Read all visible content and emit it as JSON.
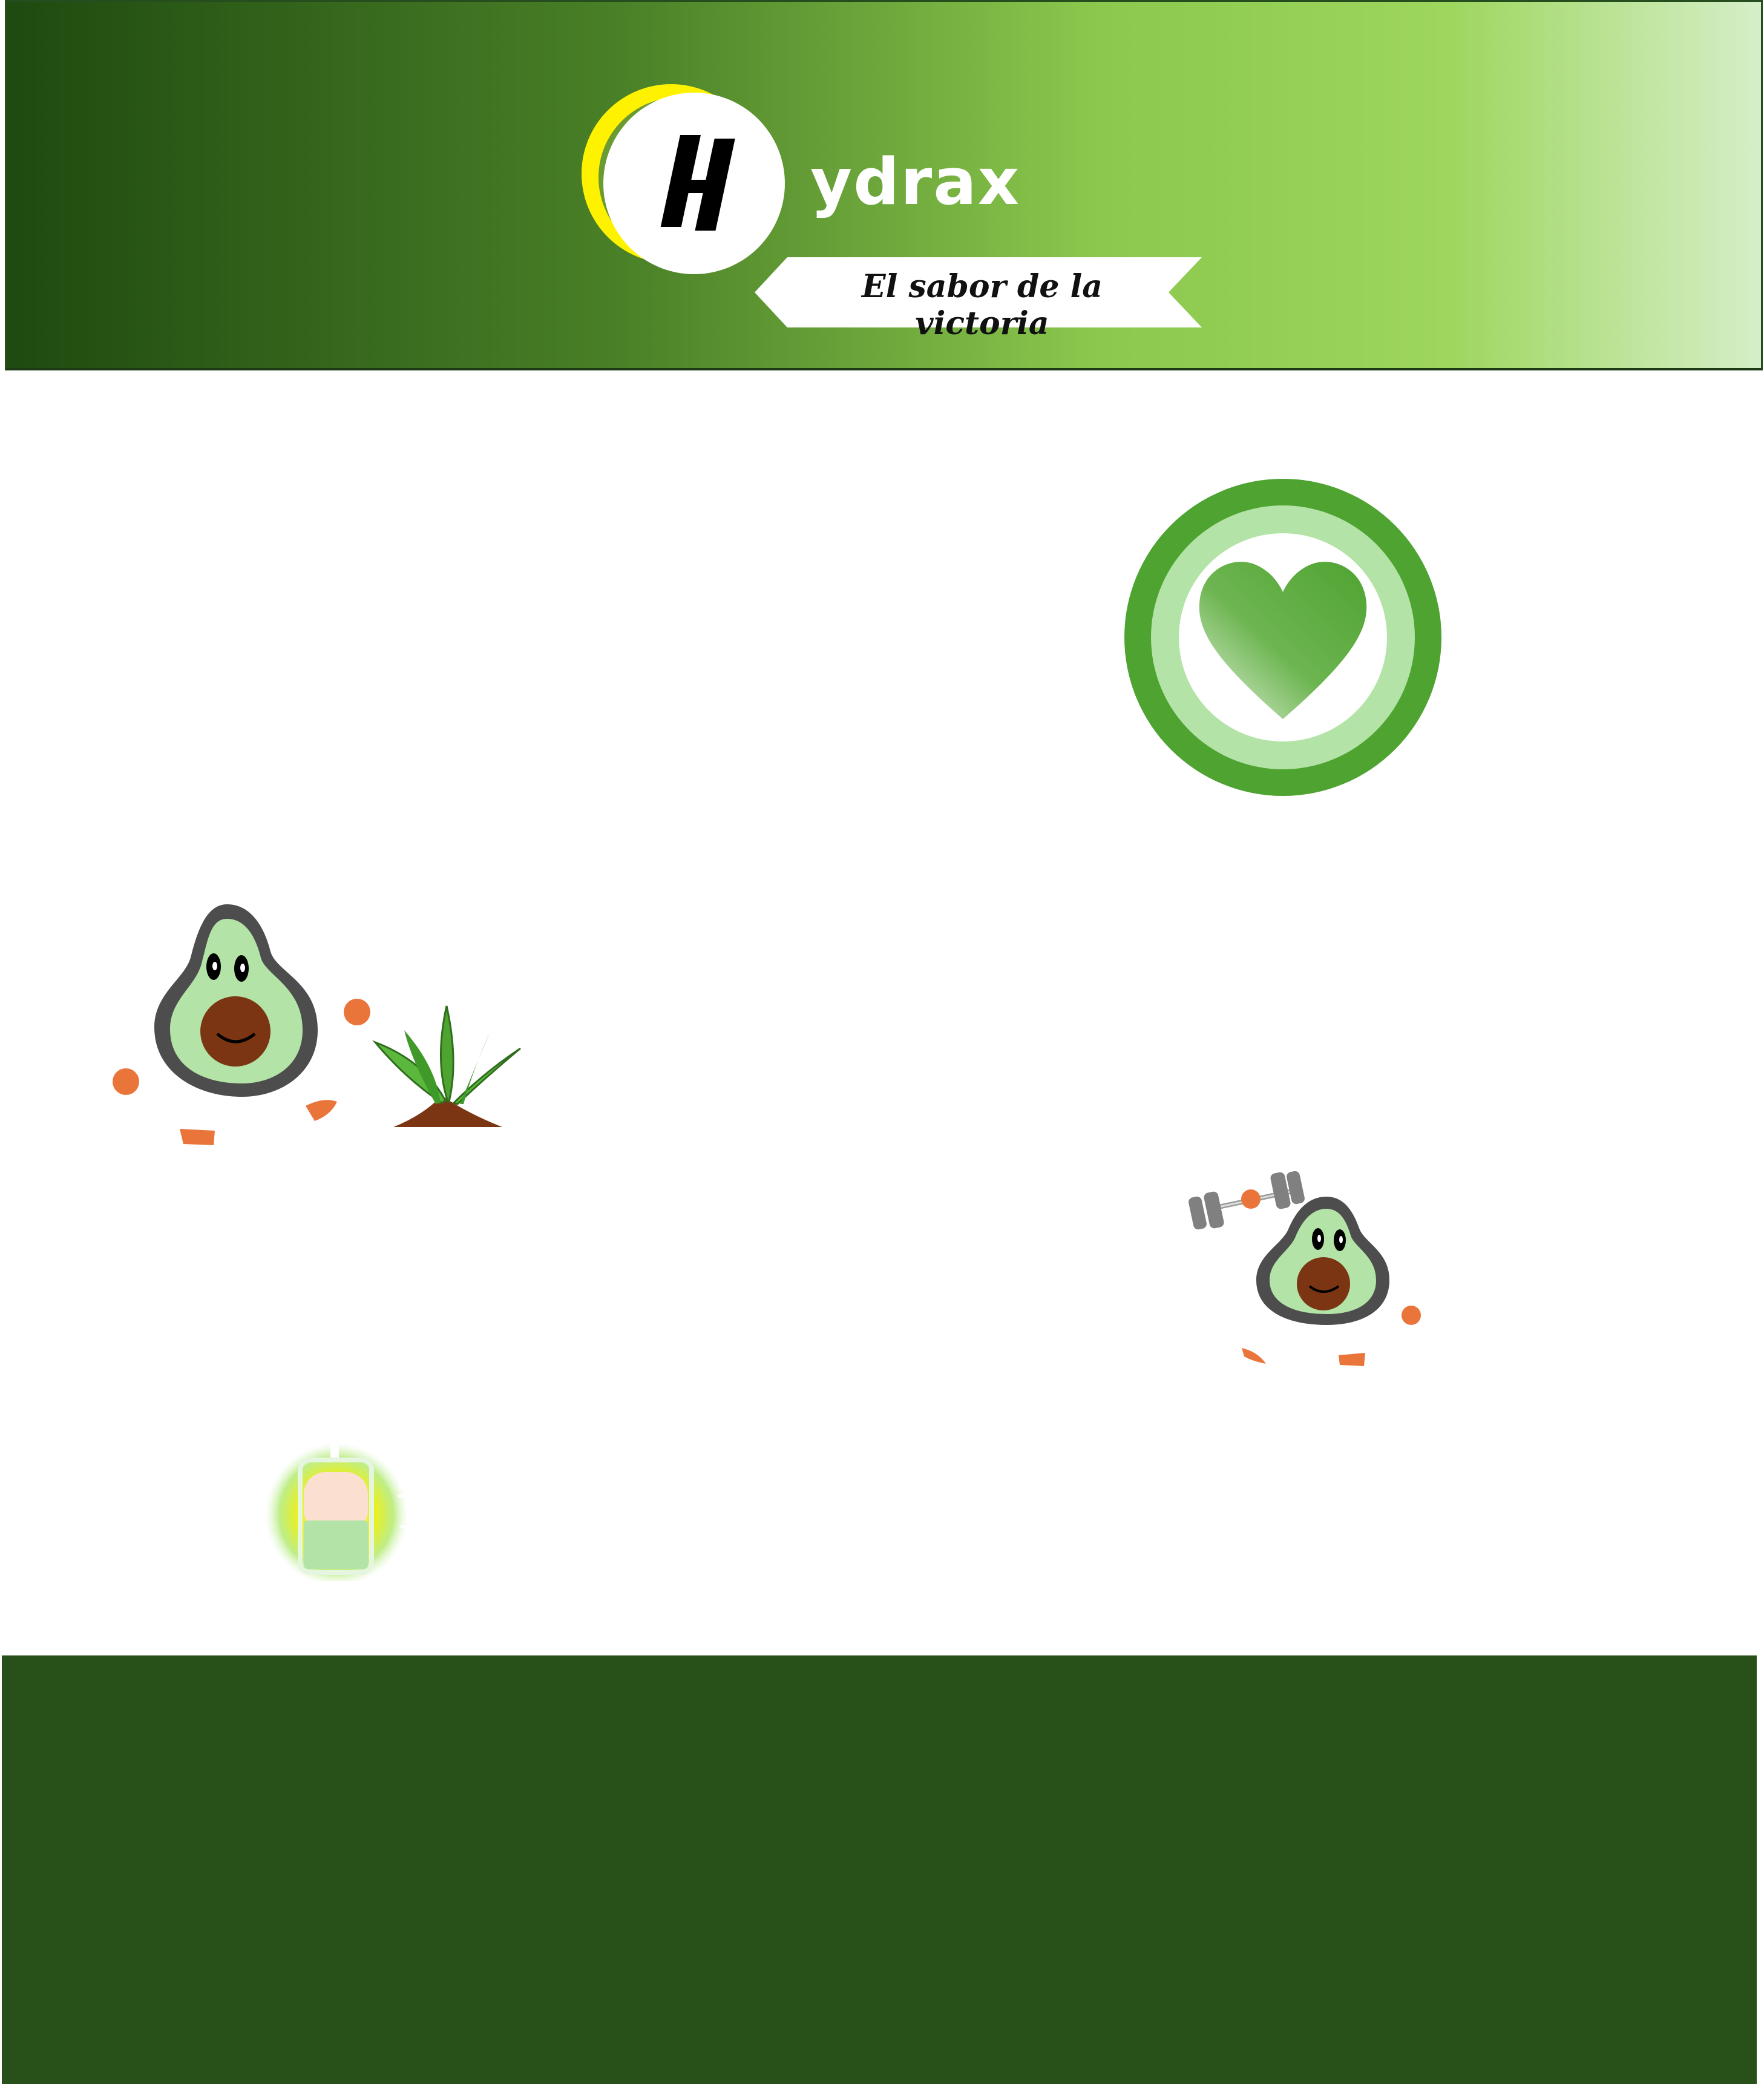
{
  "header": {
    "logo_letter": "H",
    "brand_name": "ydrax",
    "tagline": "El sabor de la victoria",
    "gradient_colors": [
      "#1f4a10",
      "#4a8027",
      "#8bc84d",
      "#9ed65e",
      "#d6efca"
    ]
  },
  "main": {
    "icons": [
      "heart-badge-icon",
      "running-avocado-icon",
      "sprout-icon",
      "weightlifting-avocado-icon",
      "smoothie-bottle-icon"
    ]
  },
  "footer": {
    "color": "#285119"
  },
  "colors": {
    "avocado_flesh": "#b3e3a6",
    "avocado_skin": "#4d4d4d",
    "avocado_pit": "#7b3512",
    "limb_orange": "#e9753b",
    "badge_green": "#4ea331",
    "badge_light": "#b3e3a6"
  }
}
